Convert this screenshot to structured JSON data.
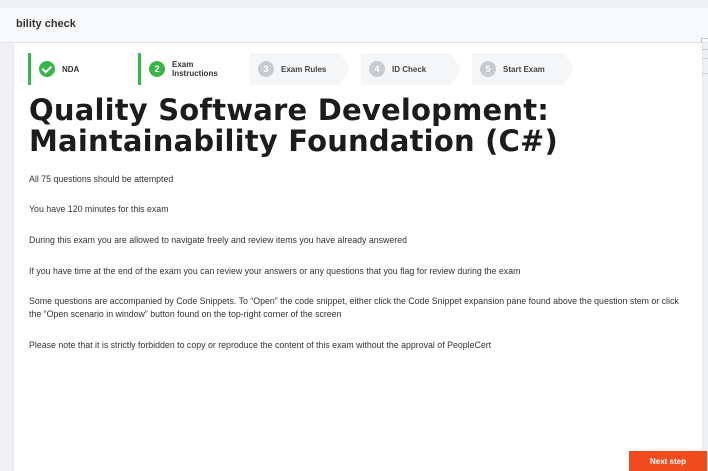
{
  "header": {
    "title": "bility check"
  },
  "steps": [
    {
      "number": "",
      "label": "NDA",
      "state": "done",
      "icon": "check-icon"
    },
    {
      "number": "2",
      "label_line1": "Exam",
      "label_line2": "Instructions",
      "state": "active"
    },
    {
      "number": "3",
      "label": "Exam Rules",
      "state": "pending"
    },
    {
      "number": "4",
      "label": "ID Check",
      "state": "pending"
    },
    {
      "number": "5",
      "label": "Start Exam",
      "state": "pending"
    }
  ],
  "exam": {
    "title_line1": "Quality Software Development:",
    "title_line2": "Maintainability Foundation (C#)"
  },
  "instructions": [
    "All 75 questions should be attempted",
    "You have 120 minutes for this exam",
    "During this exam you are allowed to navigate freely and review items you have already answered",
    "If you have time at the end of the exam you can review your answers or any questions that you flag for review during the exam",
    "Some questions are accompanied by Code Snippets. To “Open” the code snippet, either click the Code Snippet expansion pane found above the question stem or click the “Open scenario in window” button found on the top-right corner of the screen",
    "Please note that it is strictly forbidden to copy or reproduce the content of this exam without the approval of PeopleCert"
  ],
  "actions": {
    "next_label": "Next step"
  },
  "colors": {
    "accent_green": "#39b54a",
    "button_orange": "#f04a1e"
  }
}
